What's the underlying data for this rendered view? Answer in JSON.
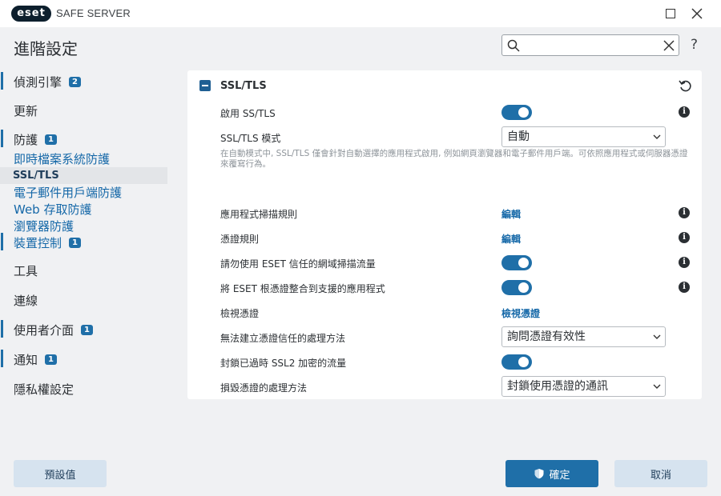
{
  "window": {
    "logo_text": "eset",
    "product_name": "SAFE SERVER"
  },
  "header": {
    "title": "進階設定",
    "search_placeholder": "",
    "help_label": "?"
  },
  "sidebar": {
    "items": [
      {
        "label": "偵測引擎",
        "badge": "2"
      },
      {
        "label": "更新",
        "badge": null
      },
      {
        "label": "防護",
        "badge": "1"
      },
      {
        "label": "即時檔案系統防護",
        "badge": null
      },
      {
        "label": "SSL/TLS",
        "badge": null
      },
      {
        "label": "電子郵件用戶端防護",
        "badge": null
      },
      {
        "label": "Web 存取防護",
        "badge": null
      },
      {
        "label": "瀏覽器防護",
        "badge": null
      },
      {
        "label": "裝置控制",
        "badge": "1"
      },
      {
        "label": "工具",
        "badge": null
      },
      {
        "label": "連線",
        "badge": null
      },
      {
        "label": "使用者介面",
        "badge": "1"
      },
      {
        "label": "通知",
        "badge": "1"
      },
      {
        "label": "隱私權設定",
        "badge": null
      }
    ]
  },
  "panel": {
    "title": "SSL/TLS",
    "description": "在自動模式中, SSL/TLS 僅會針對自動選擇的應用程式啟用, 例如網頁瀏覽器和電子郵件用戶端。可依照應用程式或伺服器憑證來覆寫行為。",
    "rows": [
      {
        "label": "啟用 SS/TLS",
        "control": "toggle",
        "value": true
      },
      {
        "label": "SSL/TLS 模式",
        "control": "select",
        "value": "自動"
      },
      {
        "label": "應用程式掃描規則",
        "control": "link",
        "value": "編輯"
      },
      {
        "label": "憑證規則",
        "control": "link",
        "value": "編輯"
      },
      {
        "label": "請勿使用 ESET 信任的網域掃描流量",
        "control": "toggle",
        "value": true
      },
      {
        "label": "將 ESET 根憑證整合到支援的應用程式",
        "control": "toggle",
        "value": true
      },
      {
        "label": "檢視憑證",
        "control": "link",
        "value": "檢視憑證"
      },
      {
        "label": "無法建立憑證信任的處理方法",
        "control": "select",
        "value": "詢問憑證有效性"
      },
      {
        "label": "封鎖已過時 SSL2 加密的流量",
        "control": "toggle",
        "value": true
      },
      {
        "label": "損毀憑證的處理方法",
        "control": "select",
        "value": "封鎖使用憑證的通訊"
      }
    ]
  },
  "footer": {
    "default_label": "預設值",
    "ok_label": "確定",
    "cancel_label": "取消"
  },
  "colors": {
    "accent": "#1f6fa8",
    "link": "#1568a8",
    "background": "#f0f1f3"
  }
}
